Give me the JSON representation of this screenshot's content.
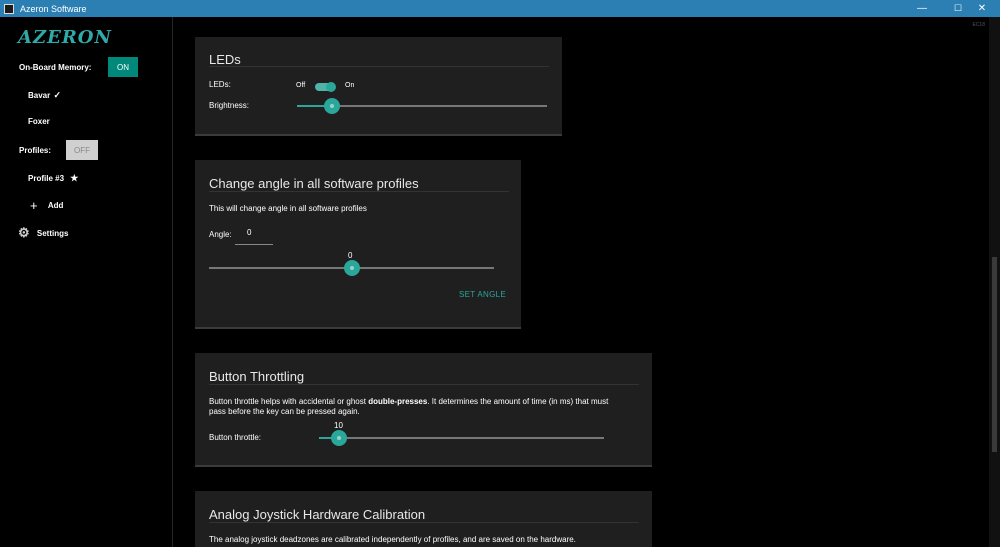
{
  "window": {
    "title": "Azeron Software",
    "controls": {
      "minimize": "—",
      "maximize": "☐",
      "close": "✕"
    }
  },
  "sidebar": {
    "logo": "AZERON",
    "onboard_label": "On-Board Memory:",
    "onboard_toggle": "ON",
    "onboard_profiles": [
      {
        "label": "Bavar",
        "marker": "✓"
      },
      {
        "label": "Foxer",
        "marker": ""
      }
    ],
    "profiles_label": "Profiles:",
    "profiles_toggle": "OFF",
    "software_profiles": [
      {
        "label": "Profile #3",
        "marker": "★"
      }
    ],
    "add_label": "Add",
    "add_icon": "+",
    "settings_label": "Settings",
    "settings_icon": "⚙"
  },
  "version": "EC18",
  "leds_card": {
    "title": "LEDs",
    "leds_label": "LEDs:",
    "switch_off": "Off",
    "switch_on": "On",
    "switch_state": true,
    "brightness_label": "Brightness:",
    "brightness_fraction": 0.14
  },
  "angle_card": {
    "title": "Change angle in all software profiles",
    "description": "This will change angle in all software profiles",
    "angle_label": "Angle:",
    "angle_value": "0",
    "slider_value": "0",
    "slider_fraction": 0.5,
    "set_button": "SET ANGLE"
  },
  "throttle_card": {
    "title": "Button Throttling",
    "desc_part1": "Button throttle helps with accidental or ghost ",
    "desc_bold": "double-presses",
    "desc_part2": ". It determines the amount of time (in ms) that must",
    "desc_line2": "pass before the key can be pressed again.",
    "throttle_label": "Button throttle:",
    "throttle_value": "10",
    "throttle_fraction": 0.07
  },
  "calibration_card": {
    "title": "Analog Joystick Hardware Calibration",
    "description": "The analog joystick deadzones are calibrated independently of profiles, and are saved on the hardware."
  }
}
